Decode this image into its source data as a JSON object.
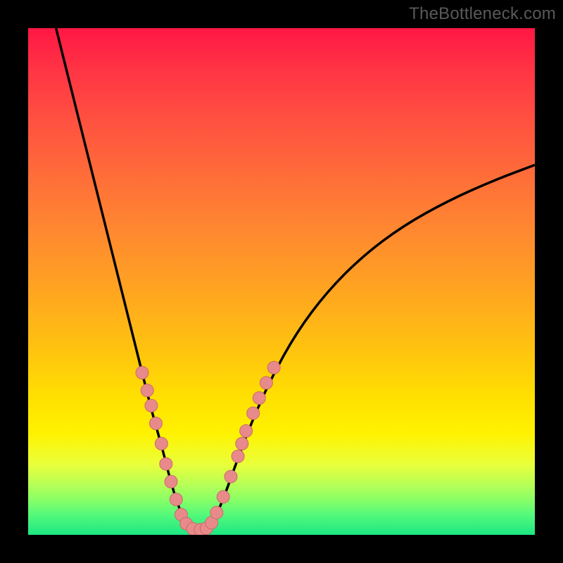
{
  "watermark": "TheBottleneck.com",
  "chart_data": {
    "type": "line",
    "title": "",
    "xlabel": "",
    "ylabel": "",
    "xlim": [
      0,
      100
    ],
    "ylim": [
      0,
      100
    ],
    "background": "rainbow-gradient-red-to-green",
    "series": [
      {
        "name": "bottleneck-curve",
        "stroke": "#000000",
        "points": [
          {
            "x": 5.5,
            "y": 100
          },
          {
            "x": 8,
            "y": 90
          },
          {
            "x": 10.5,
            "y": 80
          },
          {
            "x": 13,
            "y": 70
          },
          {
            "x": 15.5,
            "y": 60
          },
          {
            "x": 18,
            "y": 50
          },
          {
            "x": 20.5,
            "y": 40
          },
          {
            "x": 22.5,
            "y": 32
          },
          {
            "x": 24.5,
            "y": 24
          },
          {
            "x": 26.5,
            "y": 17
          },
          {
            "x": 28,
            "y": 11
          },
          {
            "x": 29.5,
            "y": 6
          },
          {
            "x": 31,
            "y": 2.5
          },
          {
            "x": 33,
            "y": 1
          },
          {
            "x": 35,
            "y": 1
          },
          {
            "x": 36.5,
            "y": 2.5
          },
          {
            "x": 38.5,
            "y": 7
          },
          {
            "x": 41,
            "y": 14
          },
          {
            "x": 44,
            "y": 22
          },
          {
            "x": 48,
            "y": 31
          },
          {
            "x": 53,
            "y": 40
          },
          {
            "x": 59,
            "y": 48
          },
          {
            "x": 66,
            "y": 55
          },
          {
            "x": 74,
            "y": 61
          },
          {
            "x": 83,
            "y": 66
          },
          {
            "x": 92,
            "y": 70
          },
          {
            "x": 100,
            "y": 73
          }
        ]
      }
    ],
    "markers": {
      "name": "data-points",
      "fill": "#e88a8a",
      "stroke": "#c96a6a",
      "points": [
        {
          "x": 22.5,
          "y": 32
        },
        {
          "x": 23.5,
          "y": 28.5
        },
        {
          "x": 24.3,
          "y": 25.5
        },
        {
          "x": 25.2,
          "y": 22
        },
        {
          "x": 26.3,
          "y": 18
        },
        {
          "x": 27.2,
          "y": 14
        },
        {
          "x": 28.2,
          "y": 10.5
        },
        {
          "x": 29.2,
          "y": 7
        },
        {
          "x": 30.2,
          "y": 4
        },
        {
          "x": 31.2,
          "y": 2.2
        },
        {
          "x": 32.5,
          "y": 1.2
        },
        {
          "x": 34,
          "y": 1
        },
        {
          "x": 35.2,
          "y": 1.3
        },
        {
          "x": 36.2,
          "y": 2.4
        },
        {
          "x": 37.2,
          "y": 4.4
        },
        {
          "x": 38.5,
          "y": 7.5
        },
        {
          "x": 40,
          "y": 11.5
        },
        {
          "x": 41.4,
          "y": 15.5
        },
        {
          "x": 42.2,
          "y": 18
        },
        {
          "x": 43,
          "y": 20.5
        },
        {
          "x": 44.4,
          "y": 24
        },
        {
          "x": 45.6,
          "y": 27
        },
        {
          "x": 47,
          "y": 30
        },
        {
          "x": 48.5,
          "y": 33
        }
      ]
    }
  }
}
